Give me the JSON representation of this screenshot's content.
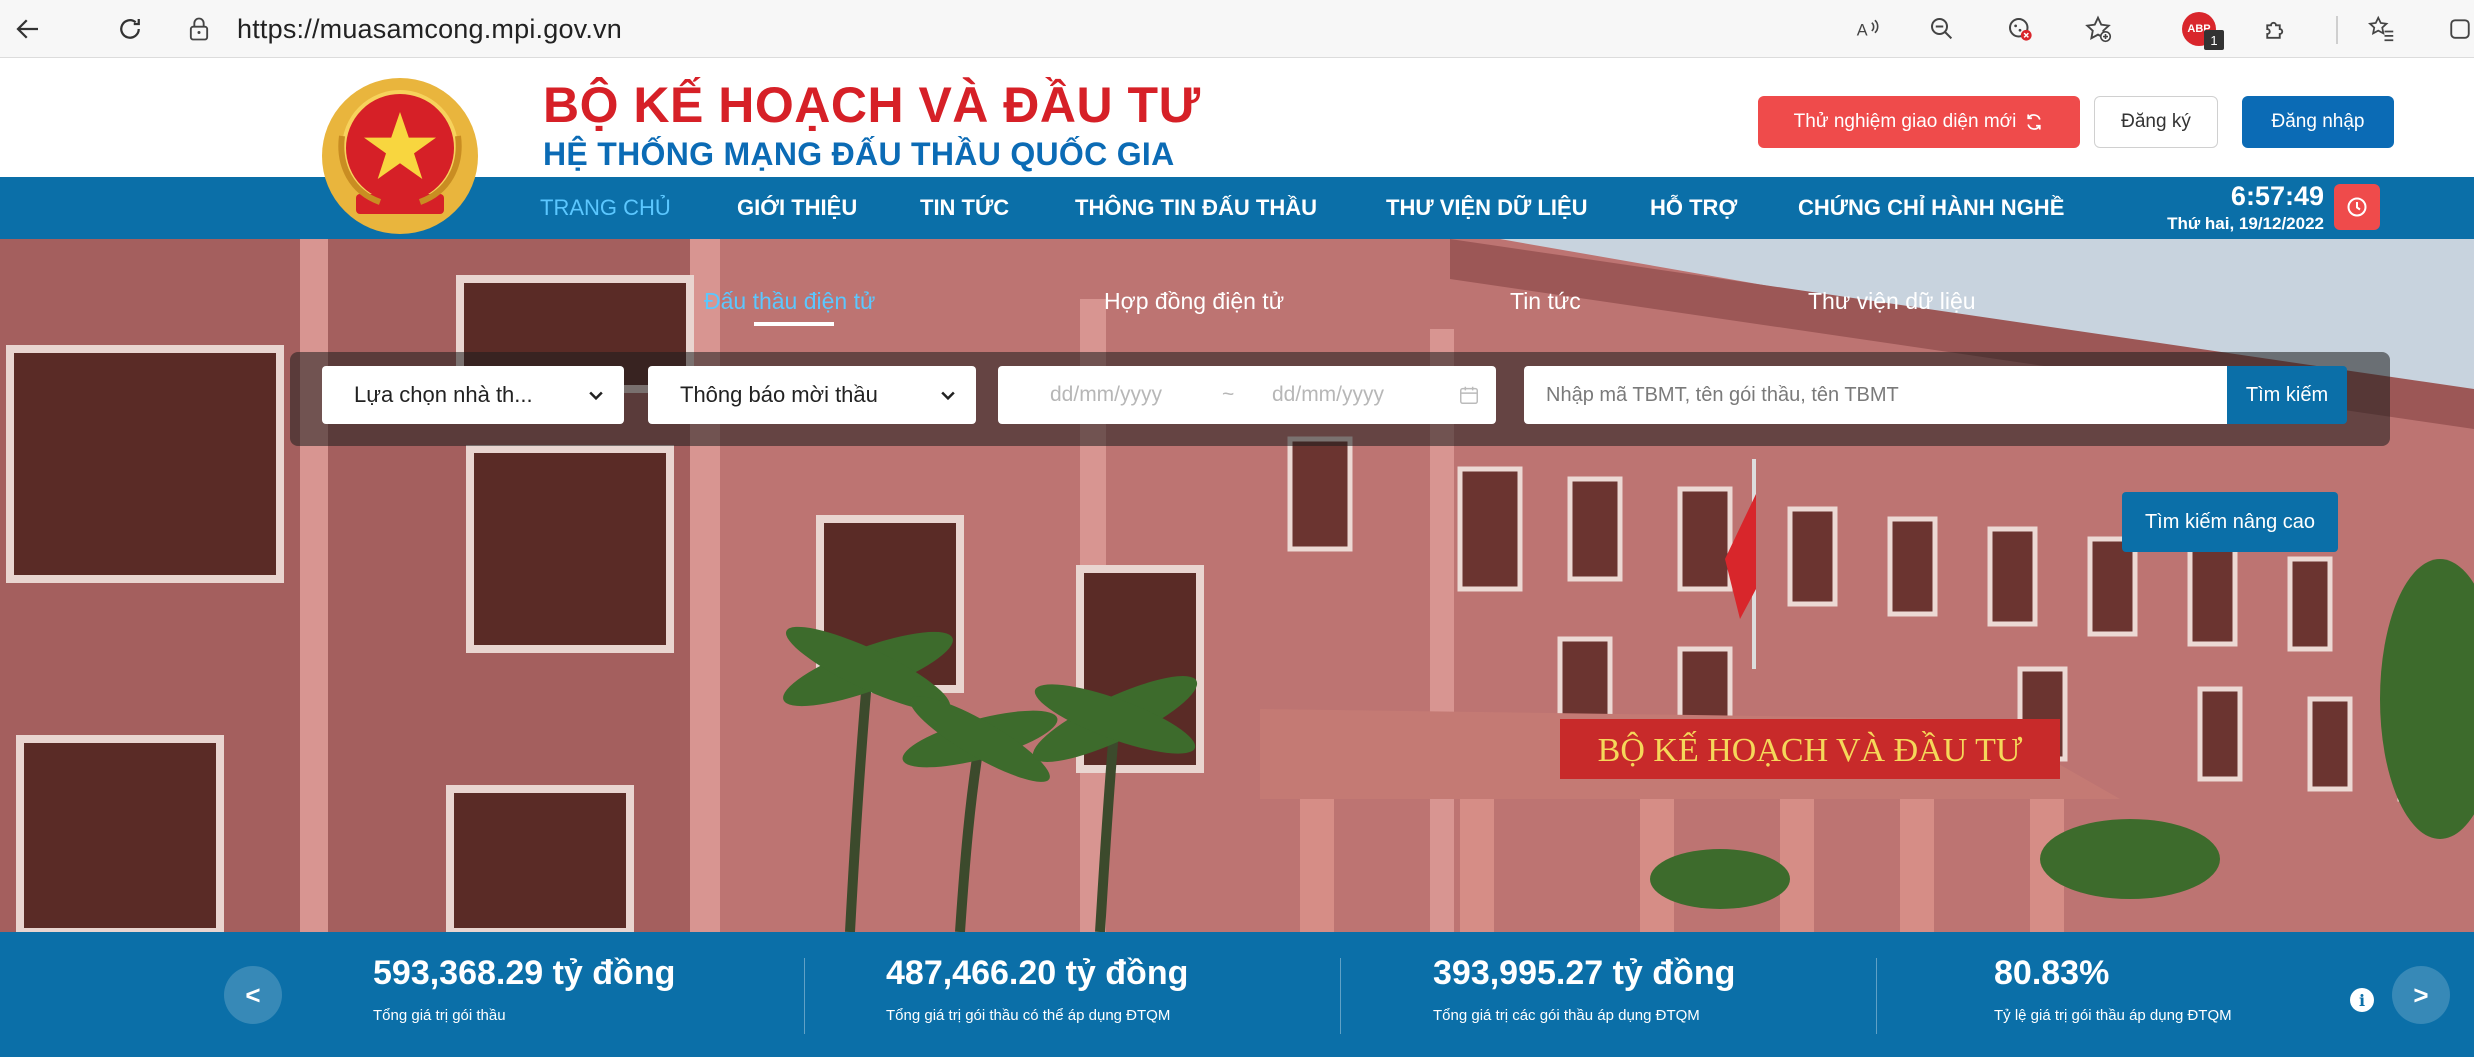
{
  "browser": {
    "url": "https://muasamcong.mpi.gov.vn",
    "adblock_count": "1"
  },
  "header": {
    "title": "BỘ KẾ HOẠCH VÀ ĐẦU TƯ",
    "subtitle": "HỆ THỐNG MẠNG ĐẤU THẦU QUỐC GIA",
    "try_new_ui": "Thử nghiệm giao diện mới",
    "register": "Đăng ký",
    "login": "Đăng nhập"
  },
  "nav": {
    "items": [
      "TRANG CHỦ",
      "GIỚI THIỆU",
      "TIN TỨC",
      "THÔNG TIN ĐẤU THẦU",
      "THƯ VIỆN DỮ LIỆU",
      "HỖ TRỢ",
      "CHỨNG CHỈ HÀNH NGHỀ"
    ],
    "time": "6:57:49",
    "date": "Thứ hai, 19/12/2022"
  },
  "hero": {
    "tabs": [
      "Đấu thầu điện tử",
      "Hợp đồng điện tử",
      "Tin tức",
      "Thư viện dữ liệu"
    ],
    "select_1": "Lựa chọn nhà th...",
    "select_2": "Thông báo mời thầu",
    "date_from_placeholder": "dd/mm/yyyy",
    "date_sep": "~",
    "date_to_placeholder": "dd/mm/yyyy",
    "keyword_placeholder": "Nhập mã TBMT, tên gói thầu, tên TBMT",
    "search_button": "Tìm kiếm",
    "advanced_search_button": "Tìm kiếm nâng cao",
    "sign_text": "BỘ KẾ HOẠCH VÀ ĐẦU TƯ"
  },
  "stats": {
    "prev": "<",
    "next": ">",
    "items": [
      {
        "value": "593,368.29 tỷ đồng",
        "label": "Tổng giá trị gói thầu"
      },
      {
        "value": "487,466.20 tỷ đồng",
        "label": "Tổng giá trị gói thầu có thể áp dụng ĐTQM"
      },
      {
        "value": "393,995.27 tỷ đồng",
        "label": "Tổng giá trị các gói thầu áp dụng ĐTQM"
      },
      {
        "value": "80.83%",
        "label": "Tỷ lệ giá trị gói thầu áp dụng ĐTQM"
      }
    ]
  },
  "colors": {
    "brand_red": "#d62027",
    "brand_blue": "#0b6bb5",
    "nav_blue": "#0b6fa8",
    "active_cyan": "#5bc7ff",
    "alert_red": "#ef4b4b"
  }
}
